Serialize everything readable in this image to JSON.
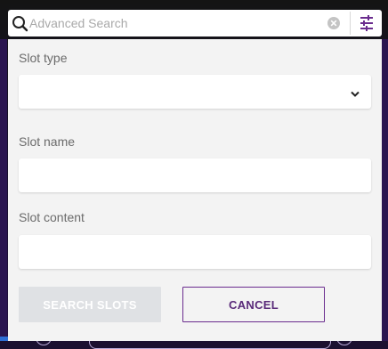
{
  "search": {
    "placeholder": "Advanced Search",
    "value": "",
    "icon": "search-icon",
    "clear_icon": "clear-icon",
    "filter_icon": "sliders-icon"
  },
  "form": {
    "slot_type": {
      "label": "Slot type",
      "value": ""
    },
    "slot_name": {
      "label": "Slot name",
      "value": ""
    },
    "slot_content": {
      "label": "Slot content",
      "value": ""
    }
  },
  "actions": {
    "search_label": "SEARCH SLOTS",
    "cancel_label": "CANCEL"
  },
  "colors": {
    "accent": "#6a2c8e",
    "disabled_button": "#dfe1e4",
    "panel_background": "#f3f3f3"
  }
}
